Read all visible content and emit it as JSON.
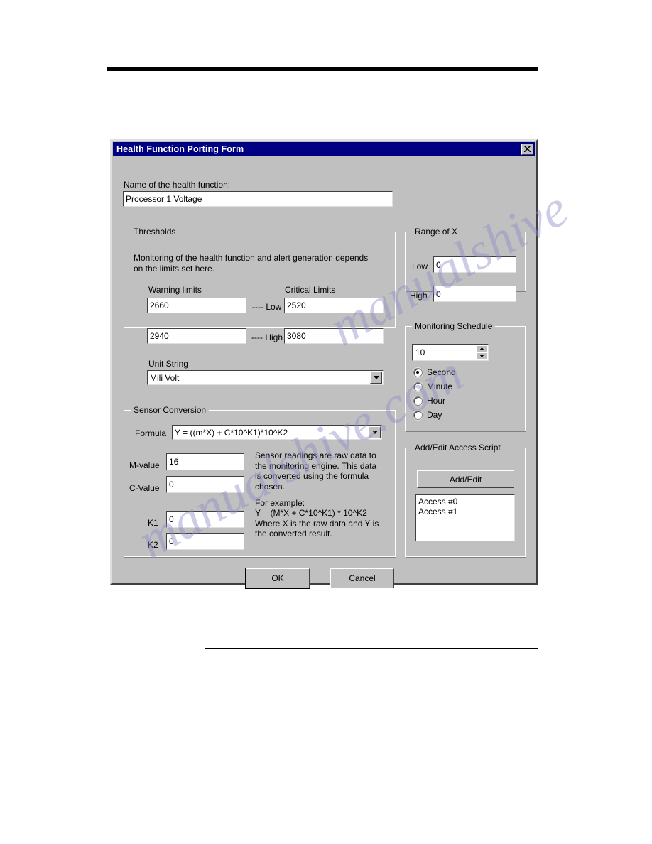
{
  "window": {
    "title": "Health Function Porting Form",
    "close_icon": "close-icon"
  },
  "name_section": {
    "label": "Name of the health function:",
    "value": "Processor 1 Voltage",
    "placeholder": ""
  },
  "thresholds": {
    "group_title": "Thresholds",
    "description": "Monitoring of the health function and alert generation depends on the limits set here.",
    "warning_header": "Warning limits",
    "critical_header": "Critical Limits",
    "low_separator": "---- Low ----",
    "high_separator": "---- High ----",
    "warning_low": "2660",
    "critical_low": "2520",
    "warning_high": "2940",
    "critical_high": "3080",
    "unit_label": "Unit String",
    "unit_value": "Mili Volt"
  },
  "sensor_conversion": {
    "group_title": "Sensor Conversion",
    "formula_label": "Formula",
    "formula_value": "Y = ((m*X) + C*10^K1)*10^K2",
    "m_label": "M-value",
    "m_value": "16",
    "c_label": "C-Value",
    "c_value": "0",
    "k1_label": "K1",
    "k1_value": "0",
    "k2_label": "K2",
    "k2_value": "0",
    "help_1": "Sensor readings are raw data to the monitoring engine. This data is converted using the formula chosen.",
    "help_2_heading": "For example:",
    "help_2_body": "Y = (M*X + C*10^K1) * 10^K2\nWhere X is the raw data and Y is the converted result."
  },
  "range_of_x": {
    "group_title": "Range of X",
    "low_label": "Low",
    "low_value": "0",
    "high_label": "High",
    "high_value": "0"
  },
  "monitoring_schedule": {
    "group_title": "Monitoring Schedule",
    "interval_value": "10",
    "up_icon": "spinner-up-icon",
    "down_icon": "spinner-down-icon",
    "options": [
      {
        "label": "Second",
        "selected": true
      },
      {
        "label": "Minute",
        "selected": false
      },
      {
        "label": "Hour",
        "selected": false
      },
      {
        "label": "Day",
        "selected": false
      }
    ]
  },
  "access_script": {
    "group_title": "Add/Edit Access Script",
    "button_label": "Add/Edit",
    "items": [
      "Access #0",
      "Access #1"
    ]
  },
  "footer": {
    "ok_label": "OK",
    "cancel_label": "Cancel"
  },
  "watermark": {
    "line1": "manualshive",
    "line2": "manualshive.com"
  },
  "colors": {
    "titlebar": "#000082",
    "dialog_face": "#c0c0c0",
    "field_bg": "#ffffff",
    "shadow": "#808080",
    "highlight": "#ffffff"
  }
}
